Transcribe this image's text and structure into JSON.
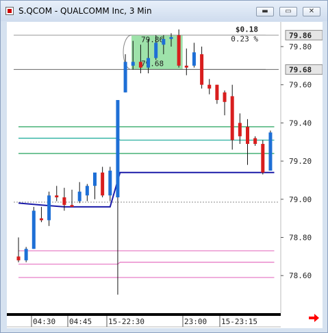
{
  "window": {
    "title": "S.QCOM - QUALCOMM Inc, 3 Min",
    "buttons": {
      "minimize": "▬",
      "restore": "▭",
      "close": "✕"
    }
  },
  "chart_data": {
    "type": "candlestick",
    "ylim": [
      78.5,
      79.9
    ],
    "y_ticks": [
      79.8,
      79.6,
      79.4,
      79.2,
      79.0,
      78.8,
      78.6
    ],
    "y_tick_labels": [
      "79.80",
      "79.60",
      "79.40",
      "79.20",
      "79.00",
      "78.80",
      "78.60"
    ],
    "price_tags": [
      {
        "value": 79.86,
        "label": "79.86"
      },
      {
        "value": 79.68,
        "label": "79.68"
      }
    ],
    "x_tick_labels": [
      "04:30",
      "04:45",
      "15-22:30",
      "23:00",
      "15-23:15"
    ],
    "measure_tool": {
      "change": "$0.18",
      "percent": "0.23 %",
      "high_label": "79.86",
      "low_label": "79.68",
      "high": 79.86,
      "low": 79.68
    },
    "candles": [
      {
        "o": 78.7,
        "h": 78.8,
        "l": 78.67,
        "c": 78.68
      },
      {
        "o": 78.68,
        "h": 78.75,
        "l": 78.67,
        "c": 78.74
      },
      {
        "o": 78.74,
        "h": 78.96,
        "l": 78.74,
        "c": 78.94
      },
      {
        "o": 78.9,
        "h": 78.96,
        "l": 78.88,
        "c": 78.89
      },
      {
        "o": 78.89,
        "h": 79.04,
        "l": 78.86,
        "c": 79.02
      },
      {
        "o": 79.02,
        "h": 79.07,
        "l": 78.99,
        "c": 79.01
      },
      {
        "o": 79.01,
        "h": 79.06,
        "l": 78.94,
        "c": 78.97
      },
      {
        "o": 78.97,
        "h": 79.05,
        "l": 78.96,
        "c": 78.96
      },
      {
        "o": 78.99,
        "h": 79.09,
        "l": 78.98,
        "c": 79.04
      },
      {
        "o": 79.02,
        "h": 79.08,
        "l": 78.99,
        "c": 79.07
      },
      {
        "o": 79.07,
        "h": 79.12,
        "l": 79.0,
        "c": 79.14
      },
      {
        "o": 79.14,
        "h": 79.17,
        "l": 79.01,
        "c": 79.02
      },
      {
        "o": 79.02,
        "h": 79.17,
        "l": 78.99,
        "c": 79.15
      },
      {
        "o": 79.01,
        "h": 79.39,
        "l": 78.5,
        "c": 79.52
      },
      {
        "o": 79.56,
        "h": 79.76,
        "l": 79.56,
        "c": 79.72
      },
      {
        "o": 79.7,
        "h": 79.83,
        "l": 79.68,
        "c": 79.72
      },
      {
        "o": 79.72,
        "h": 79.81,
        "l": 79.66,
        "c": 79.69
      },
      {
        "o": 79.69,
        "h": 79.84,
        "l": 79.66,
        "c": 79.74
      },
      {
        "o": 79.74,
        "h": 79.86,
        "l": 79.73,
        "c": 79.82
      },
      {
        "o": 79.81,
        "h": 79.86,
        "l": 79.76,
        "c": 79.84
      },
      {
        "o": 79.84,
        "h": 79.87,
        "l": 79.8,
        "c": 79.85
      },
      {
        "o": 79.86,
        "h": 79.89,
        "l": 79.69,
        "c": 79.7
      },
      {
        "o": 79.7,
        "h": 79.79,
        "l": 79.65,
        "c": 79.69
      },
      {
        "o": 79.7,
        "h": 79.82,
        "l": 79.69,
        "c": 79.77
      },
      {
        "o": 79.76,
        "h": 79.8,
        "l": 79.58,
        "c": 79.6
      },
      {
        "o": 79.6,
        "h": 79.63,
        "l": 79.55,
        "c": 79.58
      },
      {
        "o": 79.6,
        "h": 79.6,
        "l": 79.5,
        "c": 79.52
      },
      {
        "o": 79.56,
        "h": 79.57,
        "l": 79.44,
        "c": 79.51
      },
      {
        "o": 79.54,
        "h": 79.6,
        "l": 79.26,
        "c": 79.31
      },
      {
        "o": 79.4,
        "h": 79.45,
        "l": 79.29,
        "c": 79.33
      },
      {
        "o": 79.38,
        "h": 79.42,
        "l": 79.18,
        "c": 79.29
      },
      {
        "o": 79.32,
        "h": 79.33,
        "l": 79.28,
        "c": 79.29
      },
      {
        "o": 79.29,
        "h": 79.31,
        "l": 79.13,
        "c": 79.14
      },
      {
        "o": 79.15,
        "h": 79.36,
        "l": 79.15,
        "c": 79.35
      }
    ],
    "lines": [
      {
        "name": "",
        "color": "#2ab0a0",
        "points": [
          [
            0,
            79.32
          ],
          [
            13,
            79.32
          ],
          [
            13.3,
            79.31
          ],
          [
            33.5,
            79.31
          ]
        ]
      },
      {
        "name": "",
        "color": "#22a05a",
        "points": [
          [
            0,
            79.38
          ],
          [
            33.5,
            79.38
          ]
        ]
      },
      {
        "name": "",
        "color": "#22a05a",
        "points": [
          [
            0,
            79.24
          ],
          [
            33.5,
            79.24
          ]
        ]
      },
      {
        "name": "",
        "color": "#1a1aa8",
        "points": [
          [
            0,
            78.98
          ],
          [
            3,
            78.97
          ],
          [
            6,
            78.96
          ],
          [
            9,
            78.96
          ],
          [
            12,
            78.96
          ],
          [
            13.3,
            79.14
          ],
          [
            33.5,
            79.14
          ]
        ]
      },
      {
        "name": "",
        "color": "#e87fc8",
        "points": [
          [
            0,
            78.73
          ],
          [
            33.5,
            78.73
          ]
        ]
      },
      {
        "name": "",
        "color": "#e87fc8",
        "points": [
          [
            0,
            78.66
          ],
          [
            13,
            78.66
          ],
          [
            13.3,
            78.67
          ],
          [
            33.5,
            78.67
          ]
        ]
      },
      {
        "name": "",
        "color": "#e87fc8",
        "points": [
          [
            0,
            78.59
          ],
          [
            33.5,
            78.59
          ]
        ]
      }
    ],
    "ref_lines": [
      {
        "value": 78.985,
        "color": "#888888",
        "dashed": true
      },
      {
        "value": 79.68,
        "color": "#666666",
        "dashed": false
      },
      {
        "value": 79.86,
        "color": "#999999",
        "dashed": false
      }
    ],
    "colors": {
      "up": "#1e6fd6",
      "down": "#d81e1e",
      "measure_fill": "#7ed88e",
      "arrow": "#ff0000"
    }
  }
}
